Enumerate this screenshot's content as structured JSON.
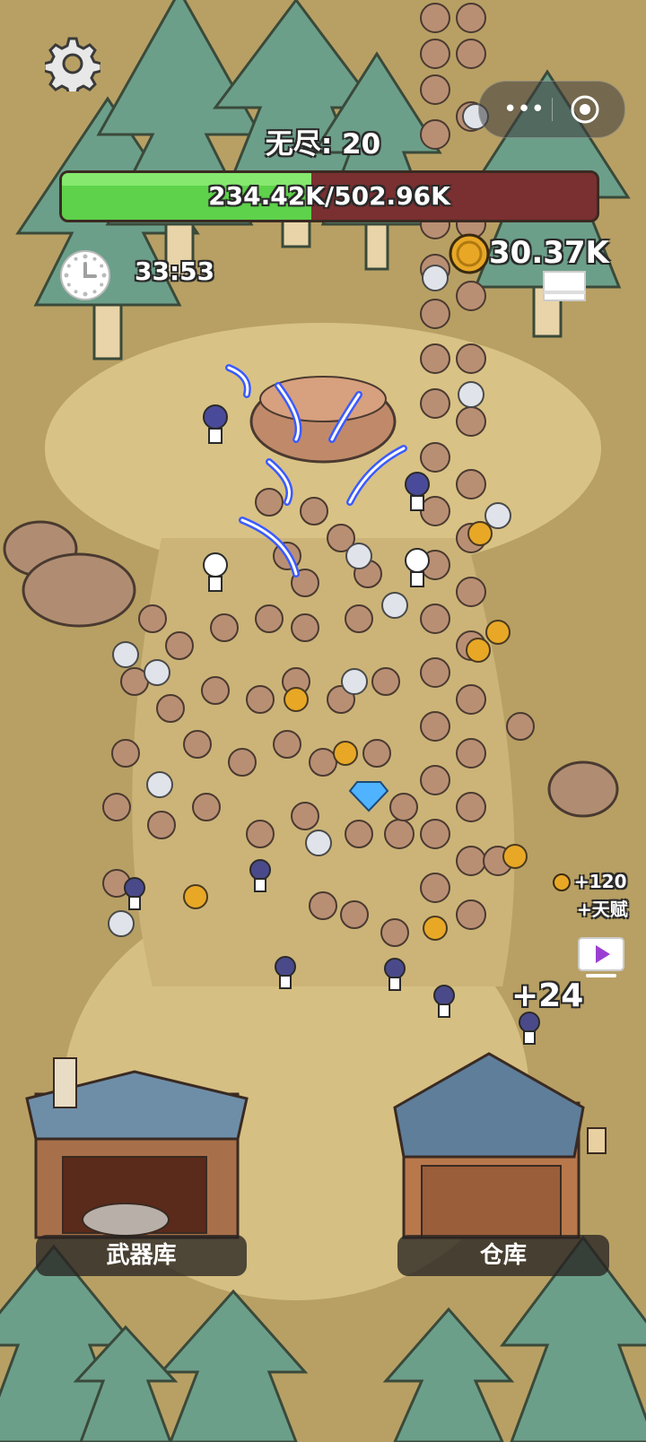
{
  "hud": {
    "mode_label": "无尽: 20",
    "boss_hp_text": "234.42K/502.96K",
    "boss_hp_current": 234420,
    "boss_hp_max": 502960,
    "timer": "33:53",
    "coins": "30.37K"
  },
  "effects": {
    "reward_coins": "+120",
    "reward_talent": "+天赋",
    "floating_gain": "+24"
  },
  "buildings": {
    "armory_label": "武器库",
    "warehouse_label": "仓库"
  },
  "icons": [
    "gear-icon",
    "more-dots-icon",
    "target-icon",
    "clock-icon",
    "coin-icon",
    "document-icon",
    "video-play-icon"
  ],
  "colors": {
    "hp_fill": "#5ed24a",
    "hp_empty": "#7a3030",
    "ground": "#b8a064",
    "path": "#dcc488",
    "tree": "#6c9f8a",
    "video_play": "#9b3fd3"
  }
}
